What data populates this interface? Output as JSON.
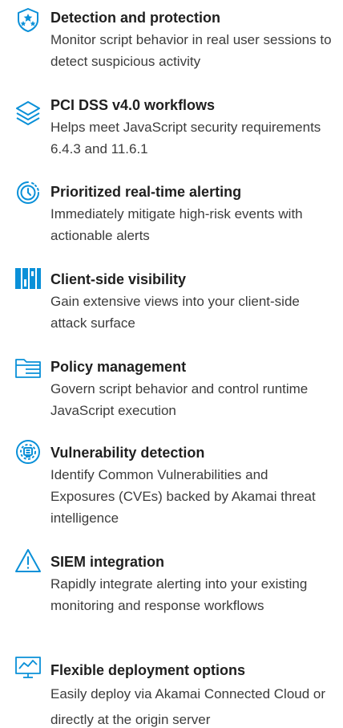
{
  "colors": {
    "icon_blue": "#0a90d8",
    "title": "#1f1f1f",
    "text": "#3c3c3c"
  },
  "features": [
    {
      "icon": "shield-stars-icon",
      "title": "Detection and protection",
      "description": "Monitor script behavior in real user sessions to detect suspicious activity"
    },
    {
      "icon": "layers-icon",
      "title": "PCI DSS v4.0 workflows",
      "description": "Helps meet JavaScript security requirements 6.4.3 and 11.6.1"
    },
    {
      "icon": "realtime-clock-icon",
      "title": "Prioritized real-time alerting",
      "description": "Immediately mitigate high-risk events with actionable alerts"
    },
    {
      "icon": "bars-icon",
      "title": "Client-side visibility",
      "description": "Gain extensive views into your client-side attack surface"
    },
    {
      "icon": "folder-icon",
      "title": "Policy management",
      "description": "Govern script behavior and control runtime JavaScript execution"
    },
    {
      "icon": "vulnerability-icon",
      "title": "Vulnerability detection",
      "description": "Identify Common Vulnerabilities and Exposures (CVEs) backed by Akamai threat intelligence"
    },
    {
      "icon": "warning-triangle-icon",
      "title": "SIEM integration",
      "description": "Rapidly integrate alerting into your existing monitoring and response workflows"
    },
    {
      "icon": "monitor-chart-icon",
      "title": "Flexible deployment options",
      "description": "Easily deploy via Akamai Connected Cloud or directly at the origin server"
    }
  ]
}
